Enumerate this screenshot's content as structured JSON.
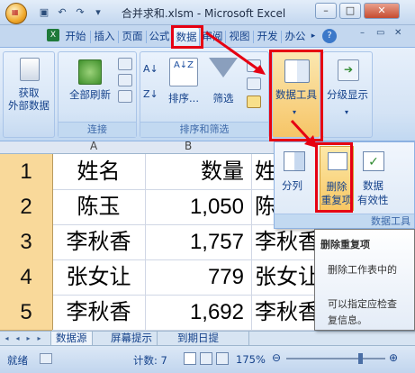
{
  "window": {
    "title": "合并求和.xlsm - Microsoft Excel",
    "minimize": "–",
    "maximize": "□",
    "close": "✕"
  },
  "qat": [
    "💾",
    "↶",
    "↷",
    "▾"
  ],
  "tabs": [
    "开始",
    "插入",
    "页面",
    "公式",
    "数据",
    "审阅",
    "视图",
    "开发",
    "办公",
    "▸"
  ],
  "ribbon": {
    "get_external": "获取\n外部数据",
    "get_external_l1": "获取",
    "get_external_l2": "外部数据",
    "refresh_all": "全部刷新",
    "group_connections": "连接",
    "sort": "排序...",
    "filter": "筛选",
    "group_sort_filter": "排序和筛选",
    "data_tools": "数据工具",
    "outline": "分级显示",
    "sort_az": "A↓Z",
    "sort_za": "Z↓A"
  },
  "dropdown": {
    "split": "分列",
    "remove_dup_l1": "删除",
    "remove_dup_l2": "重复项",
    "validation_l1": "数据",
    "validation_l2": "有效性",
    "group_label": "数据工具"
  },
  "tooltip": {
    "title": "删除重复项",
    "line1": "删除工作表中的",
    "line2": "可以指定应检查",
    "line3": "复信息。"
  },
  "columns": [
    "A",
    "B"
  ],
  "rows": [
    {
      "num": "1",
      "name": "姓名",
      "qty": "数量",
      "c": "姓"
    },
    {
      "num": "2",
      "name": "陈玉",
      "qty": "1,050",
      "c": "陈"
    },
    {
      "num": "3",
      "name": "李秋香",
      "qty": "1,757",
      "c": "李秋香"
    },
    {
      "num": "4",
      "name": "张女让",
      "qty": "779",
      "c": "张女让"
    },
    {
      "num": "5",
      "name": "李秋香",
      "qty": "1,692",
      "c": "李秋香"
    }
  ],
  "sheets": [
    "数据源",
    "屏幕提示",
    "到期日提"
  ],
  "status": {
    "ready": "就绪",
    "count": "计数: 7",
    "zoom": "175%"
  },
  "colors": {
    "highlight": "#e60012",
    "row_header": "#f9d99a",
    "ribbon": "#d4e3f5"
  }
}
